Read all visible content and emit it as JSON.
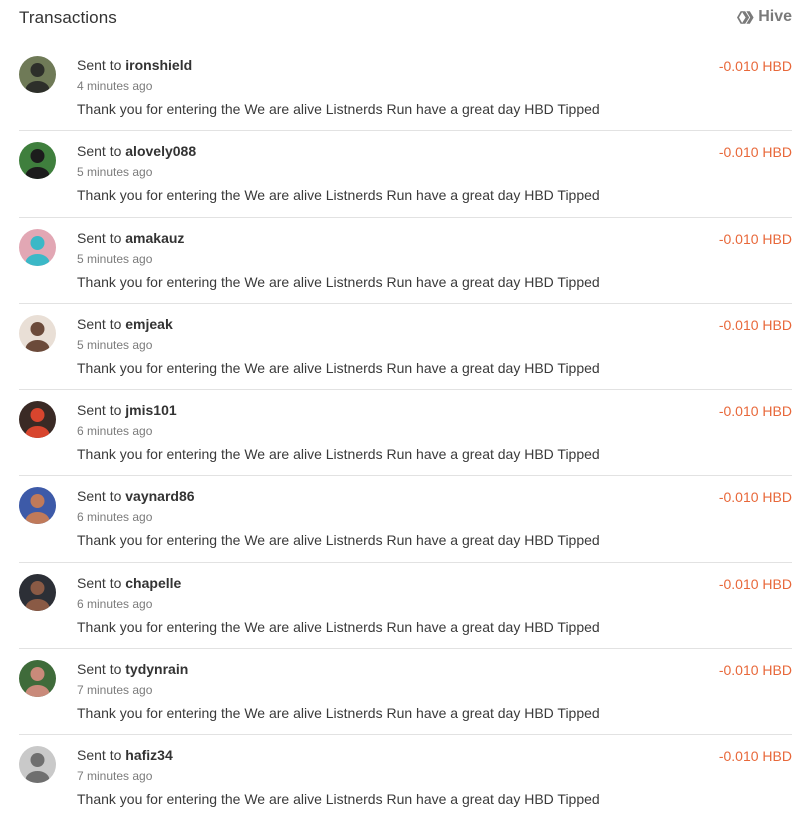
{
  "header": {
    "title": "Transactions",
    "brand_label": "Hive",
    "brand_icon": "hive-logo-icon"
  },
  "colors": {
    "amount": "#e8683a",
    "divider": "#e2e2e2",
    "text": "#333333",
    "muted": "#7b7b7b",
    "brand": "#7a7a7a"
  },
  "transactions": [
    {
      "prefix": "Sent to",
      "user": "ironshield",
      "time": "4 minutes ago",
      "memo": "Thank you for entering the We are alive Listnerds Run have a great day HBD Tipped",
      "amount": "-0.010 HBD",
      "avatar_bg": "#6f7a57",
      "avatar_fg": "#2d2f2a"
    },
    {
      "prefix": "Sent to",
      "user": "alovely088",
      "time": "5 minutes ago",
      "memo": "Thank you for entering the We are alive Listnerds Run have a great day HBD Tipped",
      "amount": "-0.010 HBD",
      "avatar_bg": "#3f7f3d",
      "avatar_fg": "#1c1c1c"
    },
    {
      "prefix": "Sent to",
      "user": "amakauz",
      "time": "5 minutes ago",
      "memo": "Thank you for entering the We are alive Listnerds Run have a great day HBD Tipped",
      "amount": "-0.010 HBD",
      "avatar_bg": "#e2a7b4",
      "avatar_fg": "#3bb8c7"
    },
    {
      "prefix": "Sent to",
      "user": "emjeak",
      "time": "5 minutes ago",
      "memo": "Thank you for entering the We are alive Listnerds Run have a great day HBD Tipped",
      "amount": "-0.010 HBD",
      "avatar_bg": "#e9dfd6",
      "avatar_fg": "#6b4a3a"
    },
    {
      "prefix": "Sent to",
      "user": "jmis101",
      "time": "6 minutes ago",
      "memo": "Thank you for entering the We are alive Listnerds Run have a great day HBD Tipped",
      "amount": "-0.010 HBD",
      "avatar_bg": "#3a2a25",
      "avatar_fg": "#d8452e"
    },
    {
      "prefix": "Sent to",
      "user": "vaynard86",
      "time": "6 minutes ago",
      "memo": "Thank you for entering the We are alive Listnerds Run have a great day HBD Tipped",
      "amount": "-0.010 HBD",
      "avatar_bg": "#3d5aa8",
      "avatar_fg": "#c07a5a"
    },
    {
      "prefix": "Sent to",
      "user": "chapelle",
      "time": "6 minutes ago",
      "memo": "Thank you for entering the We are alive Listnerds Run have a great day HBD Tipped",
      "amount": "-0.010 HBD",
      "avatar_bg": "#2c2f36",
      "avatar_fg": "#8a5a45"
    },
    {
      "prefix": "Sent to",
      "user": "tydynrain",
      "time": "7 minutes ago",
      "memo": "Thank you for entering the We are alive Listnerds Run have a great day HBD Tipped",
      "amount": "-0.010 HBD",
      "avatar_bg": "#3f6b3a",
      "avatar_fg": "#c98a7a"
    },
    {
      "prefix": "Sent to",
      "user": "hafiz34",
      "time": "7 minutes ago",
      "memo": "Thank you for entering the We are alive Listnerds Run have a great day HBD Tipped",
      "amount": "-0.010 HBD",
      "avatar_bg": "#c9c9c9",
      "avatar_fg": "#6f6f6f"
    }
  ]
}
